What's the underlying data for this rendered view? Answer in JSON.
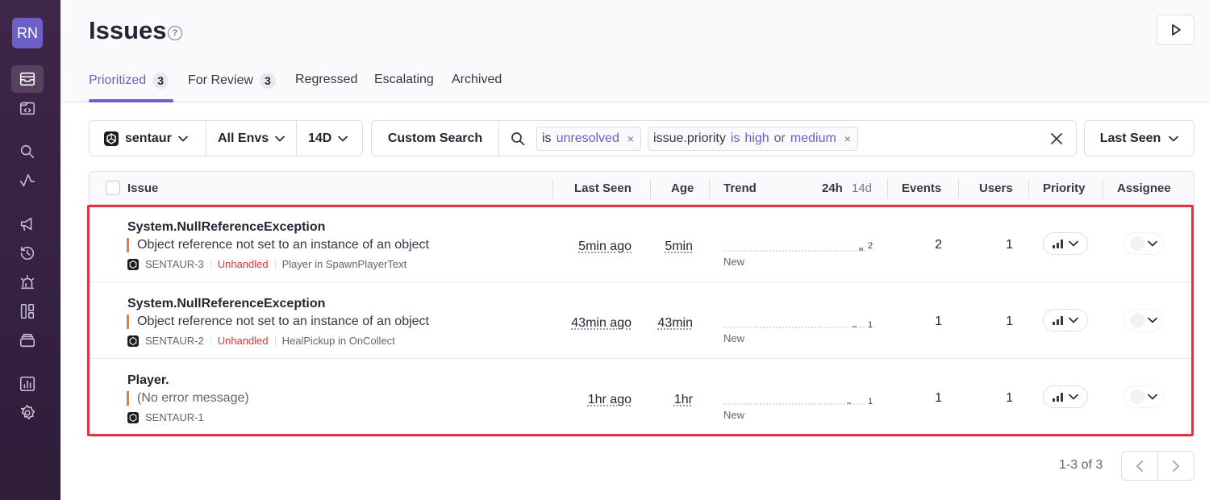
{
  "sidebar": {
    "org_initials": "RN",
    "icons": [
      "issues-icon",
      "projects-icon",
      "search-icon",
      "performance-icon",
      "feedback-icon",
      "releases-icon",
      "alerts-icon",
      "dashboards-icon",
      "crons-icon",
      "stats-icon",
      "settings-icon"
    ]
  },
  "header": {
    "title": "Issues",
    "help": "?",
    "tabs": [
      {
        "label": "Prioritized",
        "count": "3"
      },
      {
        "label": "For Review",
        "count": "3"
      },
      {
        "label": "Regressed"
      },
      {
        "label": "Escalating"
      },
      {
        "label": "Archived"
      }
    ]
  },
  "filters": {
    "project": "sentaur",
    "environment": "All Envs",
    "period": "14D",
    "custom_search": "Custom Search",
    "tokens": [
      {
        "key": "is",
        "value": "unresolved"
      },
      {
        "key": "issue.priority",
        "operator": "is",
        "value": "high",
        "joiner": "or",
        "value2": "medium"
      }
    ],
    "token_remove": "×",
    "sort": "Last Seen"
  },
  "table": {
    "headers": {
      "issue": "Issue",
      "last_seen": "Last Seen",
      "age": "Age",
      "trend": "Trend",
      "period_24h": "24h",
      "period_14d": "14d",
      "events": "Events",
      "users": "Users",
      "priority": "Priority",
      "assignee": "Assignee"
    },
    "rows": [
      {
        "title": "System.NullReferenceException",
        "message": "Object reference not set to an instance of an object",
        "short_id": "SENTAUR-3",
        "handled": "Unhandled",
        "culprit": "Player in SpawnPlayerText",
        "last_seen": "5min ago",
        "age": "5min",
        "trend_label": "New",
        "trend_max": "2",
        "events": "2",
        "users": "1"
      },
      {
        "title": "System.NullReferenceException",
        "message": "Object reference not set to an instance of an object",
        "short_id": "SENTAUR-2",
        "handled": "Unhandled",
        "culprit": "HealPickup in OnCollect",
        "last_seen": "43min ago",
        "age": "43min",
        "trend_label": "New",
        "trend_max": "1",
        "events": "1",
        "users": "1"
      },
      {
        "title": "Player.",
        "message": "(No error message)",
        "short_id": "SENTAUR-1",
        "last_seen": "1hr ago",
        "age": "1hr",
        "trend_label": "New",
        "trend_max": "1",
        "events": "1",
        "users": "1"
      }
    ]
  },
  "pagination": {
    "summary": "1-3 of 3"
  },
  "colors": {
    "accent": "#6c5fc7",
    "sidebar": "#3e2648",
    "unhandled": "#e0313b",
    "highlight": "#e8323f",
    "error_level": "#f1743a"
  }
}
